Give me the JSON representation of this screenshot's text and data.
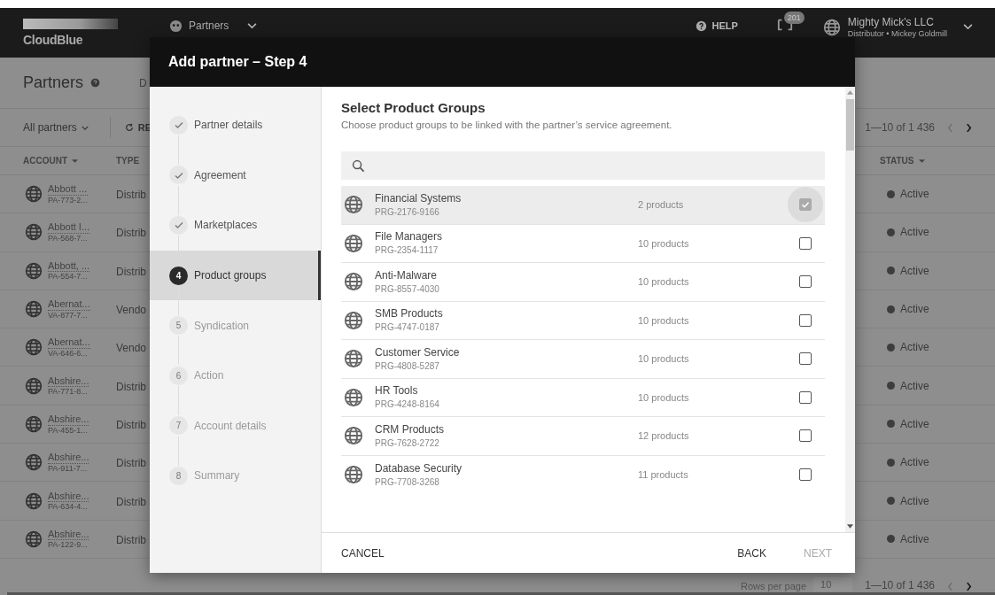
{
  "app_header": {
    "logo": "CloudBlue",
    "nav": "Partners",
    "help": "HELP",
    "notifications": "201",
    "account_name": "Mighty Mick's LLC",
    "account_role": "Distributor • Mickey Goldmill"
  },
  "page": {
    "title": "Partners",
    "tab": "D",
    "filter": "All partners",
    "refresh": "RE",
    "pagination": "1—10 of 1 436",
    "columns": [
      "ACCOUNT",
      "TYPE",
      "STATUS"
    ],
    "rows": [
      {
        "name": "Abbott ...",
        "id": "PA-773-2...",
        "type": "Distrib",
        "status": "Active"
      },
      {
        "name": "Abbott I...",
        "id": "PA-568-7...",
        "type": "Distrib",
        "status": "Active"
      },
      {
        "name": "Abbott, ...",
        "id": "PA-554-7...",
        "type": "Distrib",
        "status": "Active"
      },
      {
        "name": "Abernat...",
        "id": "VA-877-7...",
        "type": "Vendo",
        "status": "Active"
      },
      {
        "name": "Abernat...",
        "id": "VA-646-6...",
        "type": "Vendo",
        "status": "Active"
      },
      {
        "name": "Abshire...",
        "id": "PA-771-8...",
        "type": "Distrib",
        "status": "Active"
      },
      {
        "name": "Abshire...",
        "id": "PA-455-1...",
        "type": "Distrib",
        "status": "Active"
      },
      {
        "name": "Abshire...",
        "id": "PA-911-7...",
        "type": "Distrib",
        "status": "Active"
      },
      {
        "name": "Abshire...",
        "id": "PA-634-4...",
        "type": "Distrib",
        "status": "Active"
      },
      {
        "name": "Abshire...",
        "id": "PA-122-9...",
        "type": "Distrib",
        "status": "Active"
      }
    ],
    "rows_per_page_label": "Rows per page",
    "rows_per_page": "10",
    "pagination_bottom": "1—10 of 1 436"
  },
  "dialog": {
    "title": "Add partner – Step 4",
    "steps": [
      {
        "label": "Partner details",
        "completed": true,
        "selected": false
      },
      {
        "label": "Agreement",
        "completed": true,
        "selected": false
      },
      {
        "label": "Marketplaces",
        "completed": true,
        "selected": false
      },
      {
        "number": "4",
        "label": "Product groups",
        "completed": false,
        "selected": true
      },
      {
        "number": "5",
        "label": "Syndication",
        "completed": false,
        "selected": false
      },
      {
        "number": "6",
        "label": "Action",
        "completed": false,
        "selected": false
      },
      {
        "number": "7",
        "label": "Account details",
        "completed": false,
        "selected": false
      },
      {
        "number": "8",
        "label": "Summary",
        "completed": false,
        "selected": false
      }
    ],
    "heading": "Select Product Groups",
    "description": "Choose product groups to be linked with the partner’s service agreement.",
    "groups": [
      {
        "name": "Financial Systems",
        "code": "PRG-2176-9166",
        "count": "2 products",
        "checked": true,
        "focused": true
      },
      {
        "name": "File Managers",
        "code": "PRG-2354-1117",
        "count": "10 products",
        "checked": false,
        "focused": false
      },
      {
        "name": "Anti-Malware",
        "code": "PRG-8557-4030",
        "count": "10 products",
        "checked": false,
        "focused": false
      },
      {
        "name": "SMB Products",
        "code": "PRG-4747-0187",
        "count": "10 products",
        "checked": false,
        "focused": false
      },
      {
        "name": "Customer Service",
        "code": "PRG-4808-5287",
        "count": "10 products",
        "checked": false,
        "focused": false
      },
      {
        "name": "HR Tools",
        "code": "PRG-4248-8164",
        "count": "10 products",
        "checked": false,
        "focused": false
      },
      {
        "name": "CRM Products",
        "code": "PRG-7628-2722",
        "count": "12 products",
        "checked": false,
        "focused": false
      },
      {
        "name": "Database Security",
        "code": "PRG-7708-3268",
        "count": "11 products",
        "checked": false,
        "focused": false
      }
    ],
    "buttons": [
      {
        "label": "CANCEL",
        "disabled": false
      },
      {
        "label": "BACK",
        "disabled": false
      },
      {
        "label": "NEXT",
        "disabled": true
      }
    ]
  }
}
